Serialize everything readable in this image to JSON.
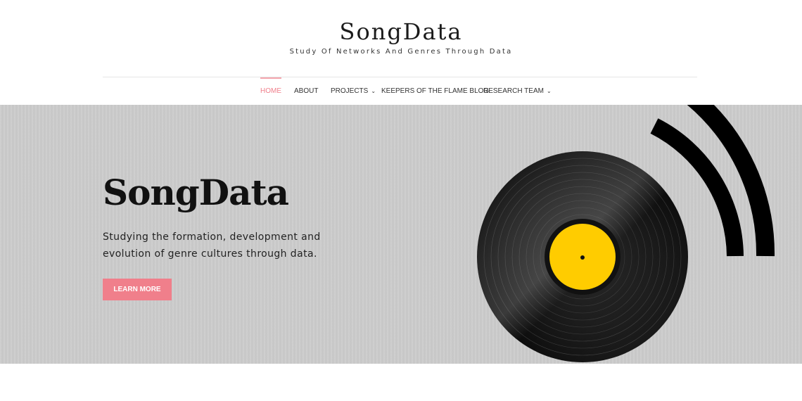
{
  "site": {
    "title": "SongData",
    "tagline": "Study Of Networks And Genres Through Data"
  },
  "nav": {
    "items": [
      {
        "label": "HOME",
        "active": true,
        "has_dropdown": false
      },
      {
        "label": "ABOUT",
        "active": false,
        "has_dropdown": false
      },
      {
        "label": "PROJECTS",
        "active": false,
        "has_dropdown": true
      },
      {
        "label": "KEEPERS OF THE FLAME BLOG",
        "active": false,
        "has_dropdown": false
      },
      {
        "label": "RESEARCH TEAM",
        "active": false,
        "has_dropdown": true
      }
    ],
    "dropdown_icon": "chevron-down-icon"
  },
  "hero": {
    "title": "SongData",
    "text": "Studying the formation, development and evolution of genre cultures through data.",
    "button_label": "LEARN MORE",
    "image": "vinyl-record-icon"
  },
  "colors": {
    "accent": "#f07f8b",
    "hero_bg": "#cccccc",
    "record_label": "#ffcc00",
    "record": "#1a1a1a"
  }
}
